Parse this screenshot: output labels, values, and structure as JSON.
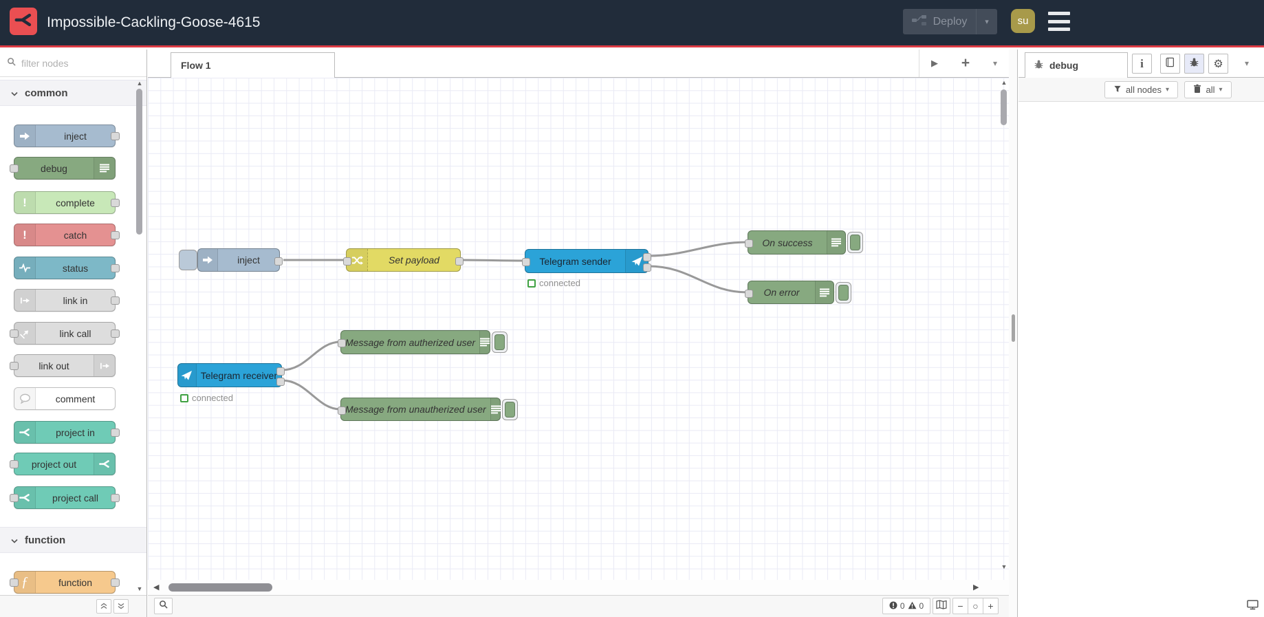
{
  "colors": {
    "header_bg": "#212c3a",
    "accent_red": "#dd3b44",
    "logo_red": "#ea4f52",
    "node_inject": "#a6bbcf",
    "node_debug": "#87a980",
    "node_complete": "#c8e8b8",
    "node_catch": "#e49191",
    "node_status": "#7db8c7",
    "node_link": "#dddddd",
    "node_comment": "#ffffff",
    "node_project": "#6fcbb6",
    "node_function": "#f6c98d",
    "node_change": "#e2da64",
    "node_telegram": "#2ba3d8",
    "wire": "#999999",
    "status_green": "#3fa142"
  },
  "glyphs": {
    "chevron_down": "▾",
    "cat_chevron": "⌄",
    "play": "▶",
    "plus": "+",
    "minus": "−",
    "circle": "○",
    "gear": "⚙",
    "up": "▲",
    "down": "▼",
    "left": "◀",
    "right": "▶",
    "exclam": "!",
    "fn": "ƒ",
    "info": "i"
  },
  "header": {
    "title": "Impossible-Cackling-Goose-4615",
    "deploy_label": "Deploy",
    "avatar_label": "su"
  },
  "palette": {
    "filter_placeholder": "filter nodes",
    "categories": [
      {
        "label": "common",
        "items": [
          {
            "label": "inject"
          },
          {
            "label": "debug"
          },
          {
            "label": "complete"
          },
          {
            "label": "catch"
          },
          {
            "label": "status"
          },
          {
            "label": "link in"
          },
          {
            "label": "link call"
          },
          {
            "label": "link out"
          },
          {
            "label": "comment"
          },
          {
            "label": "project in"
          },
          {
            "label": "project out"
          },
          {
            "label": "project call"
          }
        ]
      },
      {
        "label": "function",
        "items": [
          {
            "label": "function"
          }
        ]
      }
    ]
  },
  "workspace": {
    "tabs": [
      {
        "label": "Flow 1"
      }
    ],
    "nodes": {
      "inject": {
        "label": "inject"
      },
      "set_payload": {
        "label": "Set payload"
      },
      "telegram_sender": {
        "label": "Telegram sender",
        "status": "connected"
      },
      "on_success": {
        "label": "On success"
      },
      "on_error": {
        "label": "On error"
      },
      "telegram_receiver": {
        "label": "Telegram receiver",
        "status": "connected"
      },
      "msg_authorized": {
        "label": "Message from autherized user"
      },
      "msg_unauthorized": {
        "label": "Message from unautherized user"
      }
    },
    "footer": {
      "error_count": "0",
      "warning_count": "0"
    }
  },
  "sidebar": {
    "debug_tab_label": "debug",
    "filter_label": "all nodes",
    "clear_label": "all"
  }
}
